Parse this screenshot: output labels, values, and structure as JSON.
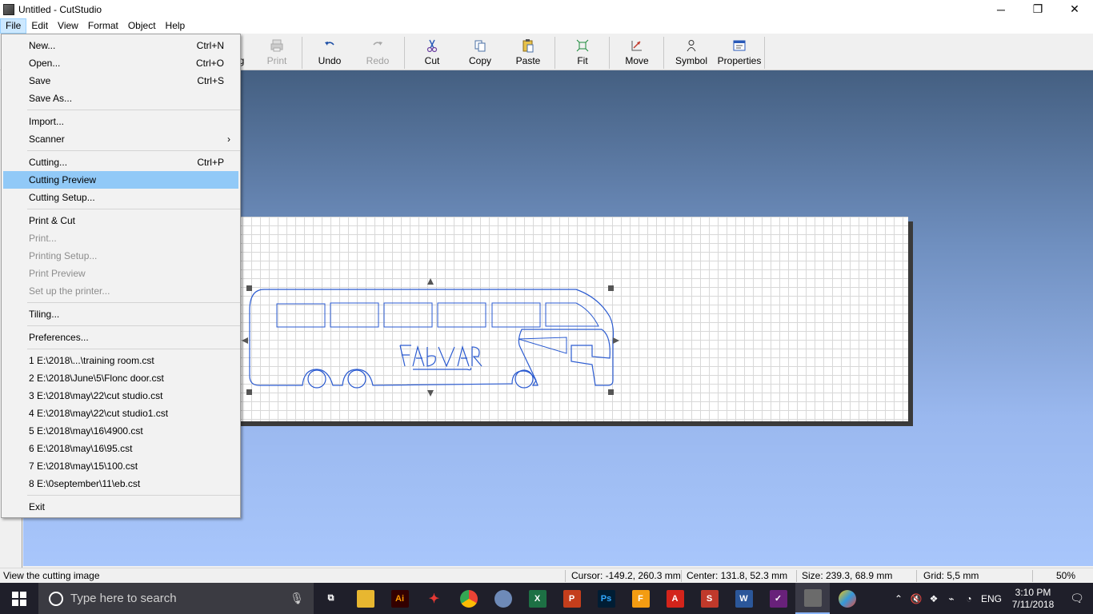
{
  "window": {
    "title": "Untitled - CutStudio",
    "minimize": "─",
    "maximize": "❐",
    "close": "✕"
  },
  "menubar": {
    "items": [
      "File",
      "Edit",
      "View",
      "Format",
      "Object",
      "Help"
    ]
  },
  "toolbar": {
    "buttons": [
      {
        "label": "g",
        "icon": "truncated-icon",
        "disabled": false
      },
      {
        "label": "Print",
        "icon": "print-icon",
        "disabled": true
      },
      {
        "label": "Undo",
        "icon": "undo-icon",
        "disabled": false
      },
      {
        "label": "Redo",
        "icon": "redo-icon",
        "disabled": true
      },
      {
        "label": "Cut",
        "icon": "scissors-icon",
        "disabled": false
      },
      {
        "label": "Copy",
        "icon": "copy-icon",
        "disabled": false
      },
      {
        "label": "Paste",
        "icon": "paste-icon",
        "disabled": false
      },
      {
        "label": "Fit",
        "icon": "fit-icon",
        "disabled": false
      },
      {
        "label": "Move",
        "icon": "move-icon",
        "disabled": false
      },
      {
        "label": "Symbol",
        "icon": "symbol-icon",
        "disabled": false
      },
      {
        "label": "Properties",
        "icon": "properties-icon",
        "disabled": false
      }
    ]
  },
  "file_menu": {
    "items": [
      {
        "label": "New...",
        "shortcut": "Ctrl+N"
      },
      {
        "label": "Open...",
        "shortcut": "Ctrl+O"
      },
      {
        "label": "Save",
        "shortcut": "Ctrl+S"
      },
      {
        "label": "Save As...",
        "shortcut": ""
      },
      {
        "label": "Import...",
        "shortcut": ""
      },
      {
        "label": "Scanner",
        "shortcut": "",
        "submenu": true
      },
      {
        "label": "Cutting...",
        "shortcut": "Ctrl+P"
      },
      {
        "label": "Cutting Preview",
        "shortcut": "",
        "highlighted": true
      },
      {
        "label": "Cutting Setup...",
        "shortcut": ""
      },
      {
        "label": "Print & Cut",
        "shortcut": ""
      },
      {
        "label": "Print...",
        "shortcut": "",
        "disabled": true
      },
      {
        "label": "Printing Setup...",
        "shortcut": "",
        "disabled": true
      },
      {
        "label": "Print Preview",
        "shortcut": "",
        "disabled": true
      },
      {
        "label": "Set up the printer...",
        "shortcut": "",
        "disabled": true
      },
      {
        "label": "Tiling...",
        "shortcut": ""
      },
      {
        "label": "Preferences...",
        "shortcut": ""
      },
      {
        "label": "1 E:\\2018\\...\\training room.cst",
        "shortcut": ""
      },
      {
        "label": "2 E:\\2018\\June\\5\\Flonc door.cst",
        "shortcut": ""
      },
      {
        "label": "3 E:\\2018\\may\\22\\cut studio.cst",
        "shortcut": ""
      },
      {
        "label": "4 E:\\2018\\may\\22\\cut studio1.cst",
        "shortcut": ""
      },
      {
        "label": "5 E:\\2018\\may\\16\\4900.cst",
        "shortcut": ""
      },
      {
        "label": "6 E:\\2018\\may\\16\\95.cst",
        "shortcut": ""
      },
      {
        "label": "7 E:\\2018\\may\\15\\100.cst",
        "shortcut": ""
      },
      {
        "label": "8 E:\\0september\\11\\eb.cst",
        "shortcut": ""
      },
      {
        "label": "Exit",
        "shortcut": ""
      }
    ]
  },
  "statusbar": {
    "message": "View the cutting image",
    "cursor": "Cursor: -149.2, 260.3 mm",
    "center": "Center: 131.8, 52.3 mm",
    "size": "Size: 239.3, 68.9 mm",
    "grid": "Grid: 5,5 mm",
    "zoom": "50%"
  },
  "taskbar": {
    "search_placeholder": "Type here to search",
    "apps": [
      {
        "name": "task-view-icon",
        "label": "⧉",
        "color": "#1f1f2a"
      },
      {
        "name": "file-explorer-icon",
        "label": "",
        "color": "#e8b730"
      },
      {
        "name": "illustrator-icon",
        "label": "Ai",
        "color": "#330000"
      },
      {
        "name": "app-red-star-icon",
        "label": "✦",
        "color": "#1f1f2a"
      },
      {
        "name": "chrome-icon",
        "label": "",
        "color": "#1f1f2a"
      },
      {
        "name": "paint-icon",
        "label": "",
        "color": "#1f1f2a"
      },
      {
        "name": "excel-icon",
        "label": "X",
        "color": "#1d7044"
      },
      {
        "name": "powerpoint-icon",
        "label": "P",
        "color": "#c43e1c"
      },
      {
        "name": "photoshop-icon",
        "label": "Ps",
        "color": "#001d34"
      },
      {
        "name": "foxit-icon",
        "label": "F",
        "color": "#f39c12"
      },
      {
        "name": "acrobat-icon",
        "label": "A",
        "color": "#d3241b"
      },
      {
        "name": "sketchup-icon",
        "label": "S",
        "color": "#c0392b"
      },
      {
        "name": "word-icon",
        "label": "W",
        "color": "#2b579a"
      },
      {
        "name": "visual-studio-icon",
        "label": "✓",
        "color": "#68217a"
      },
      {
        "name": "cutstudio-icon",
        "label": "",
        "color": "#6b6b6b",
        "running": true
      },
      {
        "name": "paint-3d-icon",
        "label": "",
        "color": "#1f1f2a"
      }
    ],
    "language": "ENG",
    "time": "3:10 PM",
    "date": "7/11/2018"
  }
}
